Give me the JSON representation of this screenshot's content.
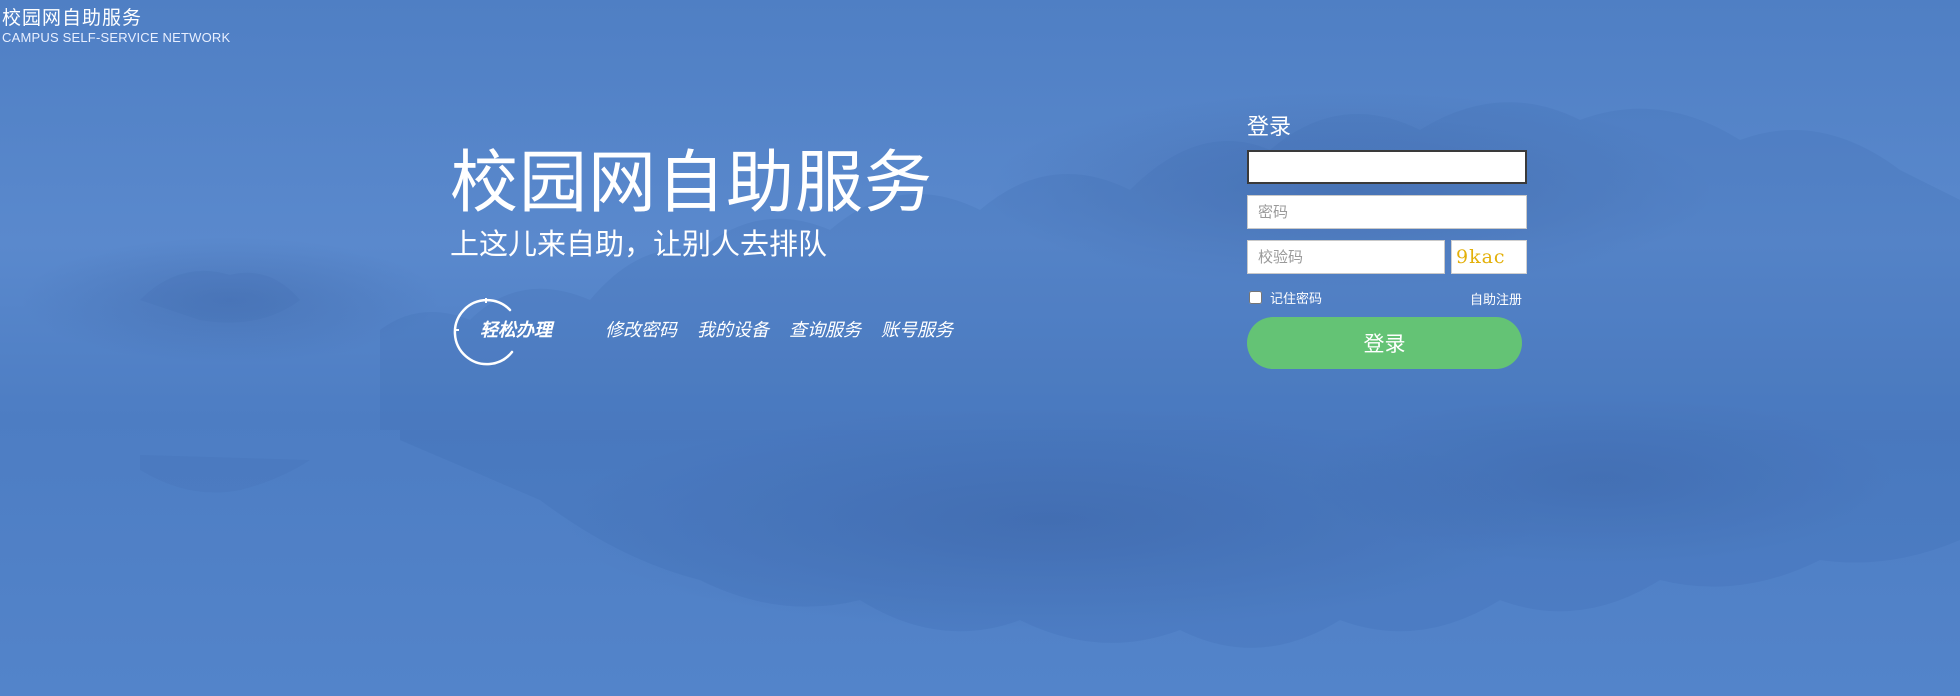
{
  "header": {
    "title": "校园网自助服务",
    "subtitle": "CAMPUS  SELF-SERVICE NETWORK"
  },
  "hero": {
    "title": "校园网自助服务",
    "slogan": "上这儿来自助，让别人去排队"
  },
  "quick": {
    "label": "轻松办理",
    "links": [
      {
        "label": "修改密码",
        "icon": "none"
      },
      {
        "label": "我的设备",
        "icon": "none"
      },
      {
        "label": "查询服务",
        "icon": "none"
      },
      {
        "label": "账号服务",
        "icon": "none"
      }
    ]
  },
  "login": {
    "title": "登录",
    "username": {
      "value": "",
      "placeholder": ""
    },
    "password": {
      "value": "",
      "placeholder": "密码"
    },
    "captcha": {
      "value": "",
      "placeholder": "校验码",
      "image_text": "9kac"
    },
    "remember_label": "记住密码",
    "remember_checked": false,
    "register_label": "自助注册",
    "submit_label": "登录"
  },
  "colors": {
    "background": "#5283c8",
    "login_button": "#64c375",
    "captcha_text": "#e3b00a"
  }
}
